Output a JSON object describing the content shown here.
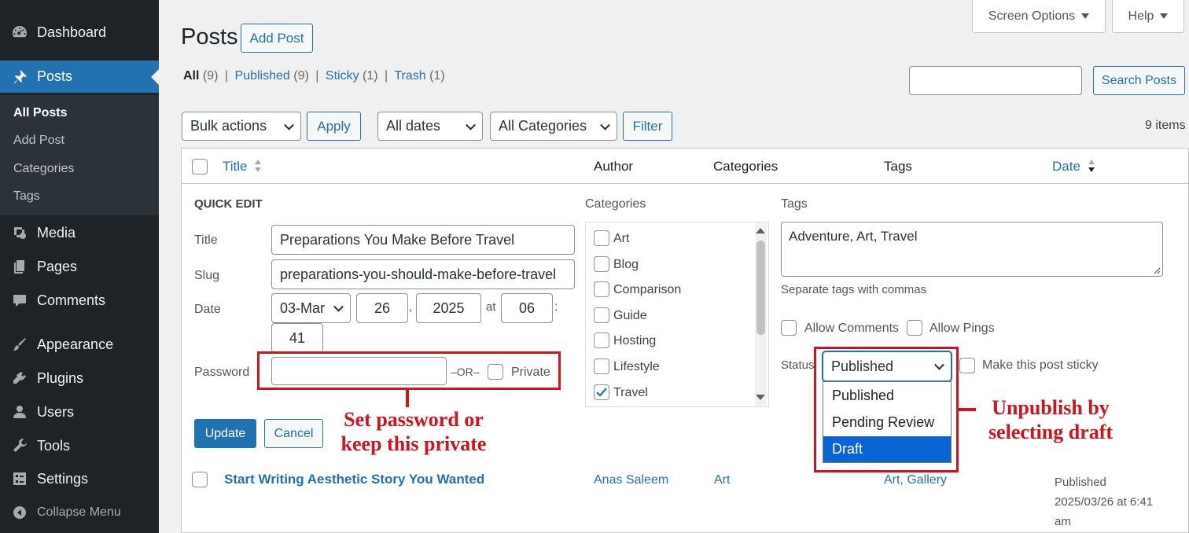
{
  "sidebar": {
    "items": [
      {
        "label": "Dashboard",
        "icon": "dashboard-icon"
      },
      {
        "label": "Posts",
        "icon": "pin-icon"
      },
      {
        "label": "Media",
        "icon": "media-icon"
      },
      {
        "label": "Pages",
        "icon": "pages-icon"
      },
      {
        "label": "Comments",
        "icon": "comments-icon"
      },
      {
        "label": "Appearance",
        "icon": "brush-icon"
      },
      {
        "label": "Plugins",
        "icon": "plugin-icon"
      },
      {
        "label": "Users",
        "icon": "users-icon"
      },
      {
        "label": "Tools",
        "icon": "wrench-icon"
      },
      {
        "label": "Settings",
        "icon": "settings-icon"
      }
    ],
    "submenu": [
      "All Posts",
      "Add Post",
      "Categories",
      "Tags"
    ],
    "collapse": "Collapse Menu"
  },
  "header": {
    "title": "Posts",
    "add_post": "Add Post",
    "screen_options": "Screen Options",
    "help": "Help"
  },
  "filters": {
    "all": "All",
    "all_count": "(9)",
    "published": "Published",
    "published_count": "(9)",
    "sticky": "Sticky",
    "sticky_count": "(1)",
    "trash": "Trash",
    "trash_count": "(1)",
    "search_button": "Search Posts",
    "bulk_actions": "Bulk actions",
    "apply": "Apply",
    "all_dates": "All dates",
    "all_categories": "All Categories",
    "filter": "Filter",
    "items_count": "9 items"
  },
  "table": {
    "columns": [
      "Title",
      "Author",
      "Categories",
      "Tags",
      "Date"
    ]
  },
  "quick_edit": {
    "heading": "QUICK EDIT",
    "title_label": "Title",
    "title_value": "Preparations You Make Before Travel",
    "slug_label": "Slug",
    "slug_value": "preparations-you-should-make-before-travel",
    "date_label": "Date",
    "month": "03-Mar",
    "day": "26",
    "year": "2025",
    "at": "at",
    "hour": "06",
    "colon": ":",
    "minute": "41",
    "comma": ",",
    "password_label": "Password",
    "password_value": "",
    "or": "–OR–",
    "private": "Private",
    "categories_label": "Categories",
    "categories": [
      {
        "name": "Art",
        "checked": false
      },
      {
        "name": "Blog",
        "checked": false
      },
      {
        "name": "Comparison",
        "checked": false
      },
      {
        "name": "Guide",
        "checked": false
      },
      {
        "name": "Hosting",
        "checked": false
      },
      {
        "name": "Lifestyle",
        "checked": false
      },
      {
        "name": "Travel",
        "checked": true
      }
    ],
    "tags_label": "Tags",
    "tags_value": "Adventure, Art, Travel",
    "tags_hint": "Separate tags with commas",
    "allow_comments": "Allow Comments",
    "allow_pings": "Allow Pings",
    "status_label": "Status",
    "status_value": "Published",
    "sticky": "Make this post sticky",
    "status_options": [
      "Published",
      "Pending Review",
      "Draft"
    ],
    "status_highlighted": "Draft",
    "update": "Update",
    "cancel": "Cancel"
  },
  "annotations": {
    "password_note_line1": "Set password or",
    "password_note_line2": "keep this private",
    "status_note_line1": "Unpublish by",
    "status_note_line2": "selecting draft",
    "color": "#d0131f"
  },
  "post_row": {
    "title": "Start Writing Aesthetic Story You Wanted",
    "author": "Anas Saleem",
    "category": "Art",
    "tags": "Art, Gallery",
    "date_status": "Published",
    "date_line1": "2025/03/26 at 6:41",
    "date_line2": "am"
  },
  "colors": {
    "sidebar": "#1d2327",
    "accent": "#2271b1",
    "highlight": "#d0131f"
  }
}
